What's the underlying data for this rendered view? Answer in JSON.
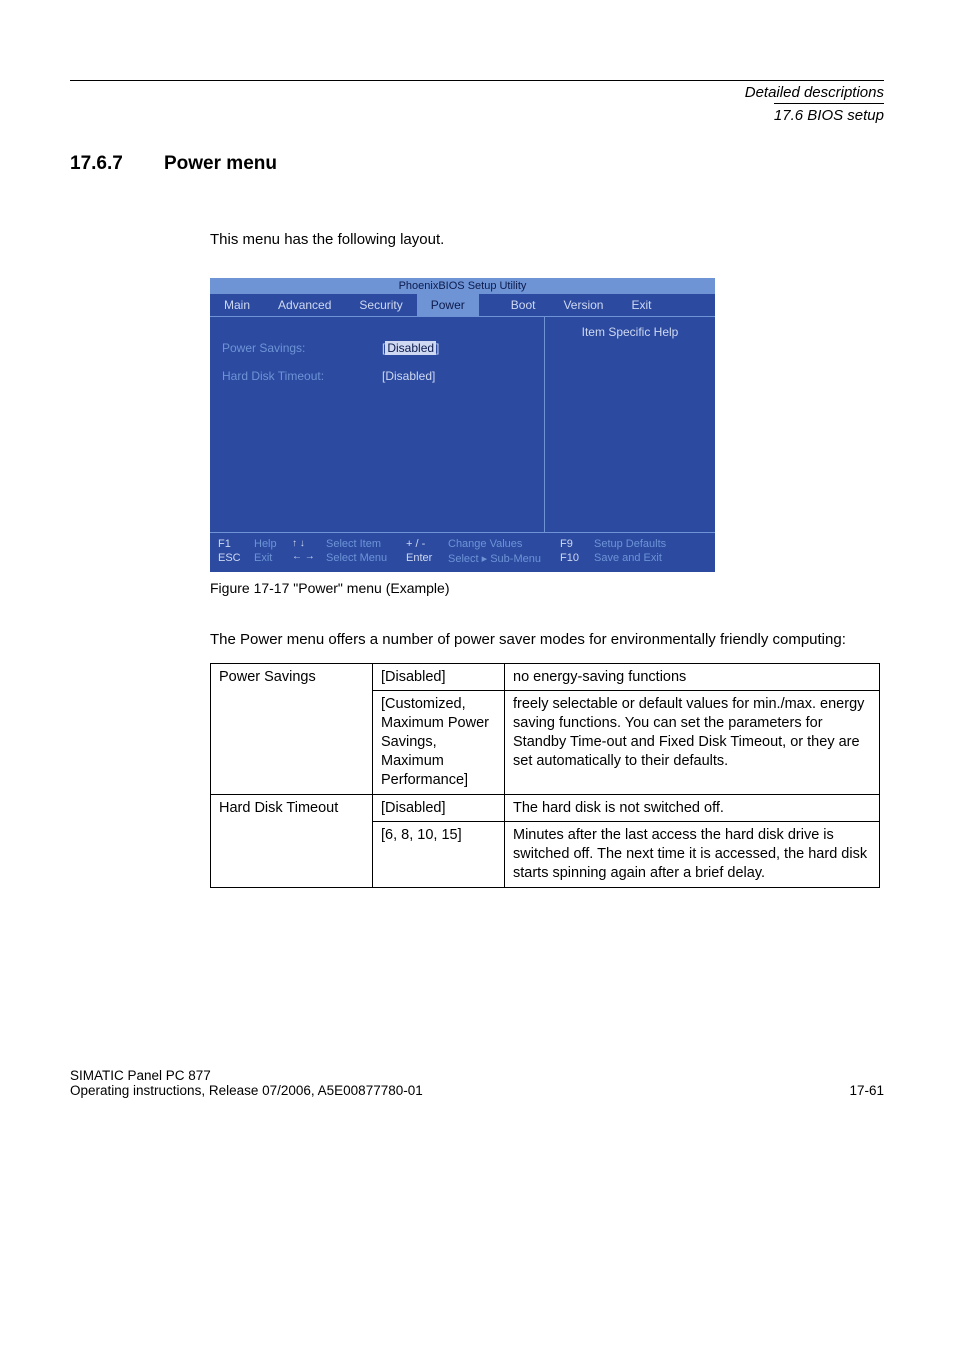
{
  "header": {
    "line1": "Detailed descriptions",
    "line2": "17.6 BIOS setup"
  },
  "section": {
    "number": "17.6.7",
    "title": "Power menu"
  },
  "intro": "This menu has the following layout.",
  "bios": {
    "utility_title": "PhoenixBIOS Setup Utility",
    "menu": {
      "main": "Main",
      "advanced": "Advanced",
      "security": "Security",
      "power": "Power",
      "boot": "Boot",
      "version": "Version",
      "exit": "Exit"
    },
    "help_title": "Item Specific Help",
    "rows": {
      "power_savings_label": "Power Savings:",
      "power_savings_value": "Disabled",
      "hard_disk_label": "Hard Disk Timeout:",
      "hard_disk_value": "[Disabled]"
    },
    "footer": {
      "f1": "F1",
      "help": "Help",
      "esc": "ESC",
      "exit": "Exit",
      "updown": "↑ ↓",
      "leftright": "← →",
      "select_item": "Select Item",
      "select_menu": "Select Menu",
      "plusminus": "+ / -",
      "enter": "Enter",
      "change_values": "Change Values",
      "select_sub": "Select ▸ Sub-Menu",
      "f9": "F9",
      "f10": "F10",
      "setup_defaults": "Setup Defaults",
      "save_exit": "Save and Exit"
    }
  },
  "figure_caption": "Figure 17-17   \"Power\" menu (Example)",
  "para2": "The Power menu offers a number of power saver modes for environmentally friendly computing:",
  "table": {
    "r1c1": "Power Savings",
    "r1c2": "[Disabled]",
    "r1c3": "no energy-saving functions",
    "r2c2": "[Customized, Maximum Power Savings, Maximum Performance]",
    "r2c3": "freely selectable or default values for min./max. energy saving functions. You can set the parameters for Standby Time-out and Fixed Disk Timeout, or they are set automatically to their defaults.",
    "r3c1": "Hard Disk Timeout",
    "r3c2": "[Disabled]",
    "r3c3": "The hard disk is not switched off.",
    "r4c2": "[6, 8, 10, 15]",
    "r4c3": "Minutes after the last access the hard disk drive is switched off. The next time it is accessed, the hard disk starts spinning again after a brief delay."
  },
  "footer": {
    "left1": "SIMATIC Panel PC 877",
    "left2": "Operating instructions, Release 07/2006, A5E00877780-01",
    "right": "17-61"
  }
}
